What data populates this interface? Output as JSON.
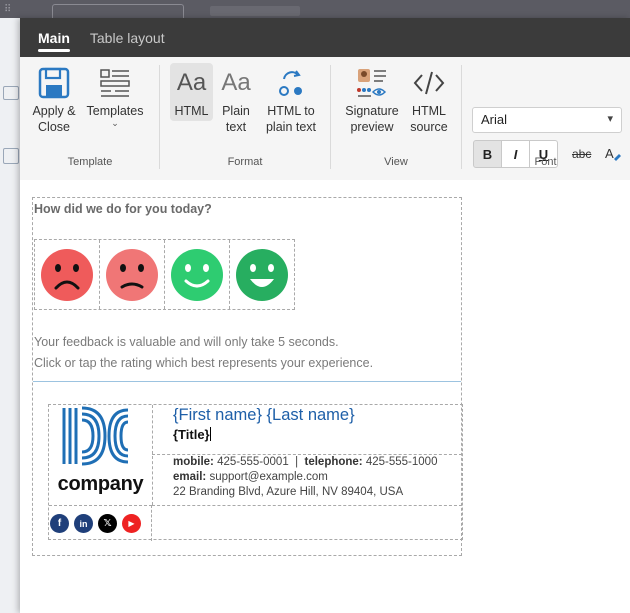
{
  "background": {
    "dots": "⠿"
  },
  "tabs": [
    {
      "label": "Main",
      "active": true
    },
    {
      "label": "Table layout",
      "active": false
    }
  ],
  "ribbon": {
    "template_group": {
      "label": "Template",
      "apply_close": "Apply & Close",
      "templates": "Templates"
    },
    "format_group": {
      "label": "Format",
      "html_icon": "Aa",
      "html": "HTML",
      "plain_icon": "Aa",
      "plain": "Plain text",
      "html_to_plain": "HTML to plain text"
    },
    "view_group": {
      "label": "View",
      "preview": "Signature preview",
      "source": "HTML source"
    },
    "font_group": {
      "label": "Font",
      "font_name": "Arial",
      "bold": "B",
      "italic": "I",
      "underline": "U",
      "strikethrough": "abc"
    }
  },
  "signature": {
    "question": "How did we do for you today?",
    "faces": [
      {
        "name": "very-unhappy",
        "color": "#ef5b5b"
      },
      {
        "name": "unhappy",
        "color": "#f07676"
      },
      {
        "name": "happy",
        "color": "#2ecc71"
      },
      {
        "name": "very-happy",
        "color": "#27ae60"
      }
    ],
    "feedback_line1": "Your feedback is valuable and will only take 5 seconds.",
    "feedback_line2": "Click or tap the rating which best represents your experience.",
    "card": {
      "company": "company",
      "name": "{First name} {Last name}",
      "title": "{Title}",
      "mobile_label": "mobile:",
      "mobile": "425-555-0001",
      "divider": "|",
      "telephone_label": "telephone:",
      "telephone": "425-555-1000",
      "email_label": "email:",
      "email": "support@example.com",
      "address": "22 Branding Blvd, Azure Hill, NV 89404, USA",
      "social": [
        {
          "name": "facebook",
          "glyph": "f",
          "color": "#1877f2"
        },
        {
          "name": "linkedin",
          "glyph": "in",
          "color": "#0a66c2"
        },
        {
          "name": "x",
          "glyph": "𝕏",
          "color": "#000000"
        },
        {
          "name": "youtube",
          "glyph": "▶",
          "color": "#ff0000"
        }
      ]
    }
  },
  "colors": {
    "accent": "#1e5fa8",
    "logo_blue": "#1f6fb5",
    "icon_blue": "#2b79c2"
  }
}
